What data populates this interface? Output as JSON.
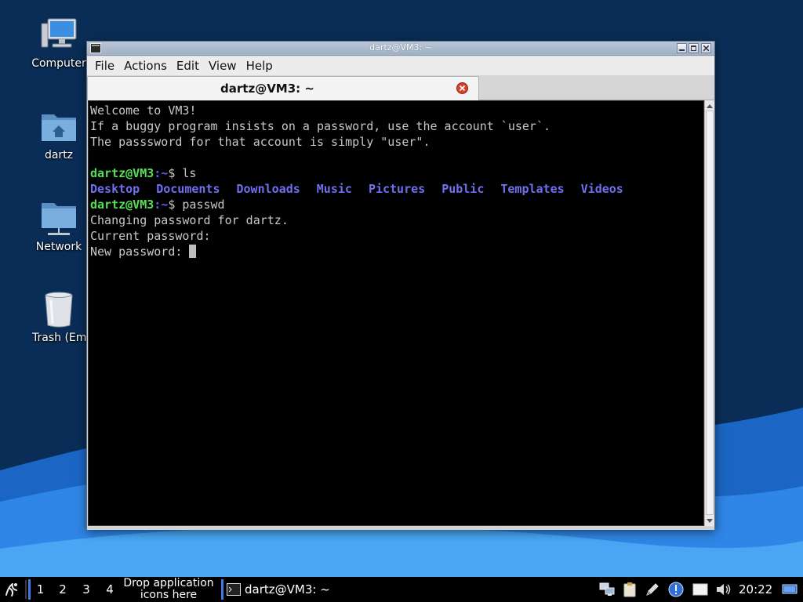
{
  "desktop": {
    "icons": [
      {
        "label": "Computer",
        "icon": "computer-icon"
      },
      {
        "label": "dartz",
        "icon": "home-folder-icon"
      },
      {
        "label": "Network",
        "icon": "network-folder-icon"
      },
      {
        "label": "Trash (Empt",
        "icon": "trash-icon"
      }
    ]
  },
  "window": {
    "title": "dartz@VM3: ~",
    "menu": [
      "File",
      "Actions",
      "Edit",
      "View",
      "Help"
    ],
    "tab_label": "dartz@VM3: ~"
  },
  "terminal": {
    "welcome": [
      "Welcome to VM3!",
      "If a buggy program insists on a password, use the account `user`.",
      "The passsword for that account is simply \"user\"."
    ],
    "prompt_user": "dartz@VM3",
    "prompt_path": ":~",
    "prompt_symbol": "$ ",
    "cmd1": "ls",
    "ls_output": [
      "Desktop",
      "Documents",
      "Downloads",
      "Music",
      "Pictures",
      "Public",
      "Templates",
      "Videos"
    ],
    "cmd2": "passwd",
    "passwd_output": [
      "Changing password for dartz.",
      "Current password:",
      "New password: "
    ]
  },
  "taskbar": {
    "workspaces": [
      "1",
      "2",
      "3",
      "4"
    ],
    "drop_text_line1": "Drop application",
    "drop_text_line2": "icons here",
    "task_label": "dartz@VM3: ~",
    "clock": "20:22",
    "tray_icons": [
      "network-icon",
      "clipboard-icon",
      "pen-icon",
      "info-icon",
      "display-icon",
      "volume-icon",
      "monitor-icon"
    ]
  },
  "colors": {
    "prompt_user": "#55e055",
    "prompt_path": "#5a63e6",
    "directory": "#6f6ff0",
    "terminal_bg": "#000000",
    "terminal_fg": "#c8c8c8",
    "taskbar_accent": "#3d7be6"
  }
}
